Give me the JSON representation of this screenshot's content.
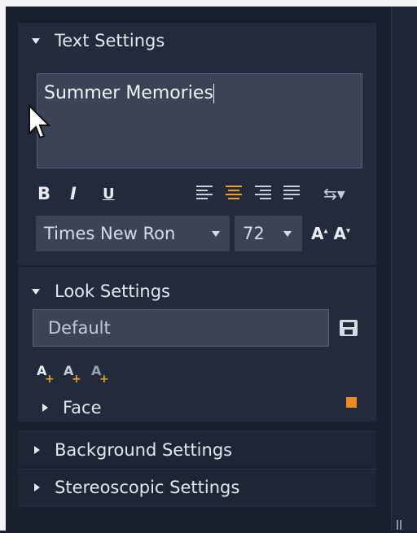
{
  "text_settings": {
    "title": "Text Settings",
    "text_value": "Summer Memories",
    "bold_label": "B",
    "italic_label": "I",
    "underline_label": "U",
    "align_active": "center",
    "font_family": "Times New Ron",
    "font_size": "72",
    "grow_label": "A",
    "shrink_label": "A"
  },
  "look_settings": {
    "title": "Look Settings",
    "preset_value": "Default",
    "add_face_label": "A",
    "add_edge_label": "A",
    "add_shadow_label": "A",
    "face_label": "Face",
    "face_color": "#f08a1c"
  },
  "background_settings": {
    "title": "Background Settings"
  },
  "stereoscopic_settings": {
    "title": "Stereoscopic Settings"
  },
  "colors": {
    "accent": "#f0a02a",
    "panel": "#222a3b",
    "field": "#3b4457"
  }
}
